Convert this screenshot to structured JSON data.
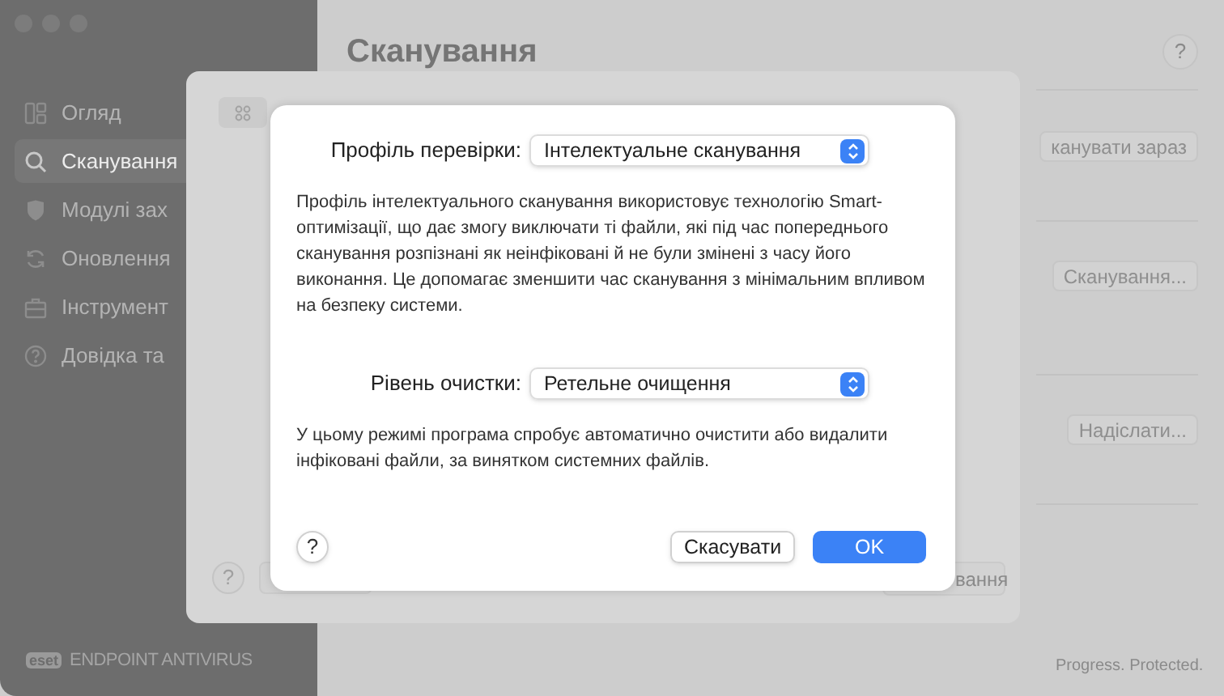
{
  "sidebar": {
    "items": [
      {
        "label": "Огляд",
        "selected": false
      },
      {
        "label": "Сканування",
        "selected": true
      },
      {
        "label": "Модулі зах",
        "selected": false
      },
      {
        "label": "Оновлення",
        "selected": false
      },
      {
        "label": "Інструмент",
        "selected": false
      },
      {
        "label": "Довідка та",
        "selected": false
      }
    ],
    "logo": "eset",
    "product": "ENDPOINT ANTIVIRUS"
  },
  "main": {
    "title": "Сканування",
    "help": "?",
    "buttons": [
      "канувати зараз",
      "Сканування...",
      "Надіслати..."
    ],
    "footer": "Progress. Protected."
  },
  "sheet": {
    "help": "?",
    "button": "вання"
  },
  "dialog": {
    "fields": [
      {
        "label": "Профіль перевірки:",
        "value": "Інтелектуальне сканування",
        "description": "Профіль інтелектуального сканування використовує технологію Smart-оптимізації, що дає змогу виключати ті файли, які під час попереднього сканування розпізнані як неінфіковані й не були змінені з часу його виконання. Це допомагає зменшити час сканування з мінімальним впливом на безпеку системи."
      },
      {
        "label": "Рівень очистки:",
        "value": "Ретельне очищення",
        "description": "У цьому режимі програма спробує автоматично очистити або видалити інфіковані файли, за винятком системних файлів."
      }
    ],
    "help": "?",
    "cancel": "Скасувати",
    "ok": "OK"
  }
}
